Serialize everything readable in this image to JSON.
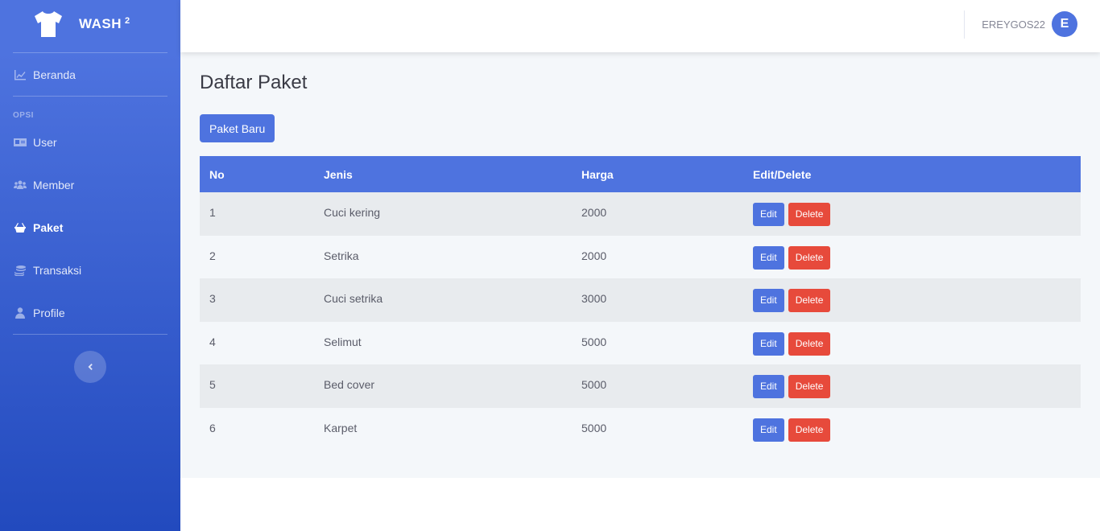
{
  "brand": {
    "name": "WASH",
    "sup": "2"
  },
  "sidebar": {
    "dashboard": {
      "label": "Beranda",
      "icon": "chart-line-icon"
    },
    "heading": "OPSI",
    "items": [
      {
        "label": "User",
        "icon": "id-card-icon"
      },
      {
        "label": "Member",
        "icon": "users-icon"
      },
      {
        "label": "Paket",
        "icon": "basket-icon",
        "active": true
      },
      {
        "label": "Transaksi",
        "icon": "coins-icon"
      },
      {
        "label": "Profile",
        "icon": "user-icon"
      }
    ]
  },
  "topbar": {
    "username": "EREYGOS22",
    "avatar": "E"
  },
  "main": {
    "title": "Daftar Paket",
    "new_button": "Paket Baru",
    "columns": [
      "No",
      "Jenis",
      "Harga",
      "Edit/Delete"
    ],
    "edit_label": "Edit",
    "delete_label": "Delete",
    "rows": [
      {
        "no": "1",
        "jenis": "Cuci kering",
        "harga": "2000"
      },
      {
        "no": "2",
        "jenis": "Setrika",
        "harga": "2000"
      },
      {
        "no": "3",
        "jenis": "Cuci setrika",
        "harga": "3000"
      },
      {
        "no": "4",
        "jenis": "Selimut",
        "harga": "5000"
      },
      {
        "no": "5",
        "jenis": "Bed cover",
        "harga": "5000"
      },
      {
        "no": "6",
        "jenis": "Karpet",
        "harga": "5000"
      }
    ]
  },
  "colors": {
    "primary": "#4e73df",
    "danger": "#e74a3b",
    "row_alt": "#e8ebee"
  }
}
